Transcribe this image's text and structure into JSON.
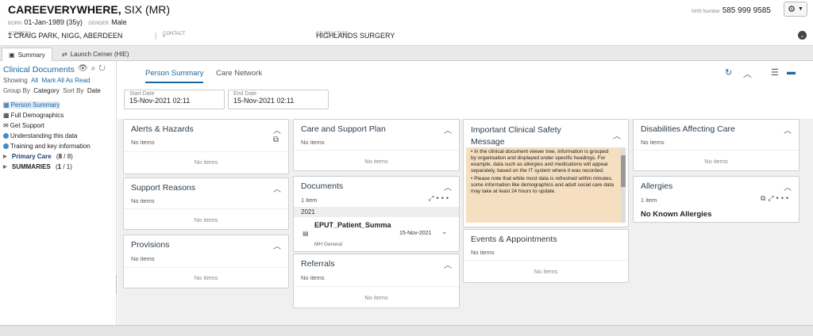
{
  "patient": {
    "surname": "CAREEVERYWHERE,",
    "forename": "SIX (MR)",
    "born_label": "BORN",
    "born": "01-Jan-1989 (35y)",
    "gender_label": "GENDER",
    "gender": "Male",
    "address_label": "ADDRESS",
    "address": "1 CRAIG PARK, NIGG, ABERDEEN",
    "contact_label": "CONTACT",
    "contact": "-",
    "gp_label": "GP PRACTICE",
    "gp": "HIGHLANDS SURGERY",
    "nhs_label": "NHS Number",
    "nhs": "585 999 9585"
  },
  "icons": {
    "settings": "gear-icon",
    "expand": "chevron-down-icon"
  },
  "tabs": [
    {
      "label": "Summary",
      "icon": "folder-icon"
    },
    {
      "label": "Launch Cerner (HIE)",
      "icon": "swap-icon"
    }
  ],
  "sidebar": {
    "title": "Clinical Documents",
    "showing_label": "Showing",
    "showing_value": "All",
    "mark_all": "Mark All As Read",
    "groupby_label": "Group By",
    "groupby_value": "Category",
    "sortby_label": "Sort By",
    "sortby_value": "Date",
    "items": [
      {
        "label": "Person Summary"
      },
      {
        "label": "Full Demographics"
      },
      {
        "label": "Get Support"
      },
      {
        "label": "Understanding this data"
      },
      {
        "label": "Training and key information"
      }
    ],
    "groups": [
      {
        "label": "Primary Care",
        "count": "8",
        "total": "8"
      },
      {
        "label": "SUMMARIES",
        "count": "1",
        "total": "1"
      }
    ]
  },
  "subtabs": [
    "Person Summary",
    "Care Network"
  ],
  "dates": {
    "start_label": "Start Date",
    "start": "15-Nov-2021 02:11",
    "end_label": "End Date",
    "end": "15-Nov-2021 02:11"
  },
  "cards": {
    "alerts": {
      "title": "Alerts & Hazards",
      "status": "No items",
      "empty": "No items"
    },
    "support": {
      "title": "Support Reasons",
      "status": "No items",
      "empty": "No items"
    },
    "provisions": {
      "title": "Provisions",
      "status": "No items",
      "empty": "No items"
    },
    "careplan": {
      "title": "Care and Support Plan",
      "status": "No items",
      "empty": "No items"
    },
    "documents": {
      "title": "Documents",
      "status": "1 item",
      "year": "2021",
      "doc_title": "EPUT_Patient_Summa",
      "doc_date": "15-Nov-2021",
      "doc_source": "MH General"
    },
    "referrals": {
      "title": "Referrals",
      "status": "No items",
      "empty": "No items"
    },
    "safety": {
      "title_line1": "Important Clinical Safety",
      "title_line2": "Message",
      "para1": "• In the clinical document viewer tree, information is grouped by organisation and displayed under specific headings. For example, data such as allergies and medications will appear separately, based on the IT system where it was recorded.",
      "para2": "• Please note that while most data is refreshed within minutes, some information like demographics and adult social care data may take at least 24 hours to update."
    },
    "events": {
      "title": "Events & Appointments",
      "status": "No items",
      "empty": "No items"
    },
    "disabilities": {
      "title": "Disabilities Affecting Care",
      "status": "No items",
      "empty": "No items"
    },
    "allergies": {
      "title": "Allergies",
      "status": "1 item",
      "value": "No Known Allergies"
    }
  }
}
